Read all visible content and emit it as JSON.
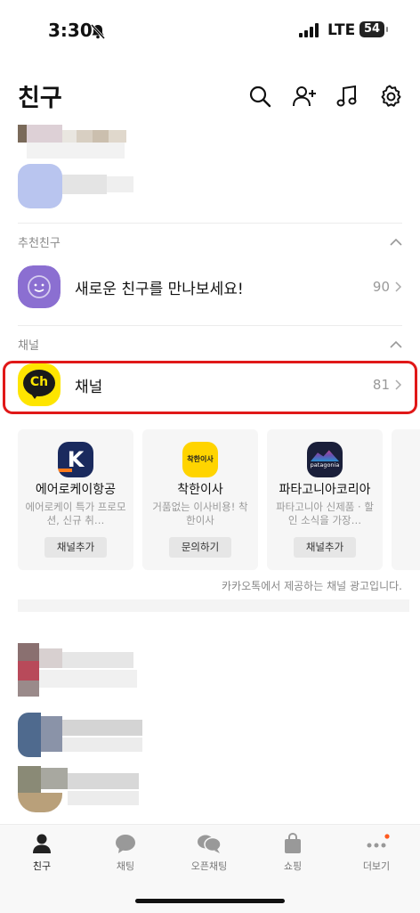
{
  "status_bar": {
    "time": "3:30",
    "network": "LTE",
    "battery": "54"
  },
  "header": {
    "title": "친구"
  },
  "sections": {
    "recommended": {
      "label": "추천친구",
      "row": {
        "name": "새로운 친구를 만나보세요!",
        "count": "90"
      }
    },
    "channel": {
      "label": "채널",
      "row": {
        "name": "채널",
        "count": "81",
        "logo_text": "Ch"
      }
    }
  },
  "channel_cards": [
    {
      "logo_text": "K",
      "name": "에어로케이항공",
      "desc": "에어로케이 특가 프로모션, 신규 취…",
      "button": "채널추가"
    },
    {
      "logo_text": "착한이사",
      "name": "착한이사",
      "desc": "거품없는 이사비용! 착한이사",
      "button": "문의하기"
    },
    {
      "logo_text": "patagonia",
      "name": "파타고니아코리아",
      "desc": "파타고니아 신제품 · 할인 소식을 가장…",
      "button": "채널추가"
    }
  ],
  "ad_note": "카카오톡에서 제공하는 채널 광고입니다.",
  "tabs": [
    {
      "label": "친구",
      "icon": "person-icon",
      "active": true
    },
    {
      "label": "채팅",
      "icon": "chat-bubble-icon"
    },
    {
      "label": "오픈채팅",
      "icon": "open-chat-icon"
    },
    {
      "label": "쇼핑",
      "icon": "shopping-bag-icon"
    },
    {
      "label": "더보기",
      "icon": "more-dots-icon",
      "badge": true
    }
  ],
  "colors": {
    "kakao_yellow": "#fee500",
    "purple_avatar": "#8b6fd1",
    "highlight_red": "#e01818",
    "aero_navy": "#1a2a5e",
    "notification_orange": "#ff5a1f"
  }
}
